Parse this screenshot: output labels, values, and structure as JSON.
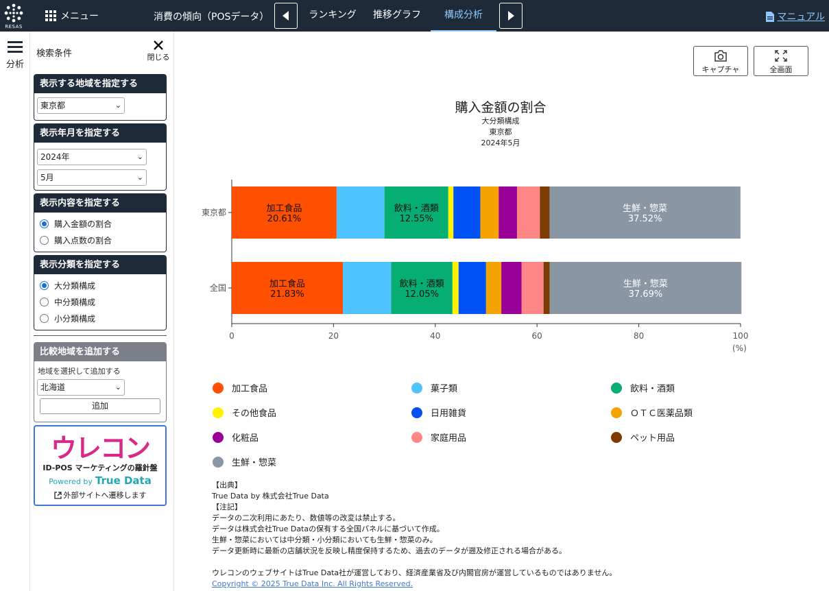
{
  "header": {
    "logo_text": "RESAS",
    "menu_label": "メニュー",
    "section_title": "消費の傾向（POSデータ）",
    "tabs": [
      {
        "label": "ランキング",
        "active": false
      },
      {
        "label": "推移グラフ",
        "active": false
      },
      {
        "label": "構成分析",
        "active": true
      }
    ],
    "manual_label": "マニュアル"
  },
  "rail": {
    "label": "分析"
  },
  "sidebar": {
    "title": "検索条件",
    "close_label": "閉じる",
    "region_panel": {
      "header": "表示する地域を指定する",
      "selected": "東京都"
    },
    "date_panel": {
      "header": "表示年月を指定する",
      "year": "2024年",
      "month": "5月"
    },
    "content_panel": {
      "header": "表示内容を指定する",
      "options": [
        "購入金額の割合",
        "購入点数の割合"
      ],
      "selected_index": 0
    },
    "class_panel": {
      "header": "表示分類を指定する",
      "options": [
        "大分類構成",
        "中分類構成",
        "小分類構成"
      ],
      "selected_index": 0
    },
    "compare_panel": {
      "header": "比較地域を追加する",
      "hint": "地域を選択して追加する",
      "selected": "北海道",
      "add_label": "追加"
    },
    "ad": {
      "logo": "ウレコン",
      "subtitle": "ID-POS マーケティングの羅針盤",
      "powered_by": "Powered by",
      "brand": "True Data",
      "link": "外部サイトへ遷移します"
    }
  },
  "toolbar": {
    "capture_label": "キャプチャ",
    "fullscreen_label": "全画面"
  },
  "chart_data": {
    "type": "bar",
    "orientation": "horizontal-stacked",
    "title": "購入金額の割合",
    "subtitles": [
      "大分類構成",
      "東京都",
      "2024年5月"
    ],
    "unit": "(%)",
    "xlim": [
      0,
      100
    ],
    "xticks": [
      0,
      20,
      40,
      60,
      80,
      100
    ],
    "categories": [
      "東京都",
      "全国"
    ],
    "series": [
      {
        "name": "加工食品",
        "color": "#fe5000",
        "values": [
          20.61,
          21.83
        ]
      },
      {
        "name": "菓子類",
        "color": "#4fc3fd",
        "values": [
          9.4,
          9.5
        ]
      },
      {
        "name": "飲料・酒類",
        "color": "#07ae73",
        "values": [
          12.55,
          12.05
        ]
      },
      {
        "name": "その他食品",
        "color": "#fff200",
        "values": [
          1.0,
          1.2
        ]
      },
      {
        "name": "日用雑貨",
        "color": "#0052f5",
        "values": [
          5.3,
          5.4
        ]
      },
      {
        "name": "ＯＴＣ医薬品類",
        "color": "#f5a300",
        "values": [
          3.6,
          3.0
        ]
      },
      {
        "name": "化粧品",
        "color": "#980097",
        "values": [
          3.6,
          4.0
        ]
      },
      {
        "name": "家庭用品",
        "color": "#ff8686",
        "values": [
          4.5,
          4.3
        ]
      },
      {
        "name": "ペット用品",
        "color": "#7d3c01",
        "values": [
          1.9,
          1.2
        ]
      },
      {
        "name": "生鮮・惣菜",
        "color": "#8a96a3",
        "values": [
          37.52,
          37.69
        ]
      }
    ],
    "bar_labels": [
      {
        "series": "加工食品",
        "texts": [
          [
            "加工食品",
            "20.61%"
          ],
          [
            "加工食品",
            "21.83%"
          ]
        ]
      },
      {
        "series": "飲料・酒類",
        "texts": [
          [
            "飲料・酒類",
            "12.55%"
          ],
          [
            "飲料・酒類",
            "12.05%"
          ]
        ]
      },
      {
        "series": "生鮮・惣菜",
        "texts": [
          [
            "生鮮・惣菜",
            "37.52%"
          ],
          [
            "生鮮・惣菜",
            "37.69%"
          ]
        ]
      }
    ],
    "legend_position": "bottom"
  },
  "notes": {
    "lines": [
      "【出典】",
      "True Data by 株式会社True Data",
      "【注記】",
      "データの二次利用にあたり、数値等の改変は禁止する。",
      "データは株式会社True Dataの保有する全国パネルに基づいて作成。",
      "生鮮・惣菜においては中分類・小分類においても生鮮・惣菜のみ。",
      "データ更新時に最新の店舗状況を反映し精度保持するため、過去のデータが遡及修正される場合がある。",
      "",
      "ウレコンのウェブサイトはTrue Data社が運営しており、経済産業省及び内閣官房が運営しているものではありません。"
    ],
    "copyright": "Copyright © 2025 True Data Inc. All Rights Reserved."
  }
}
